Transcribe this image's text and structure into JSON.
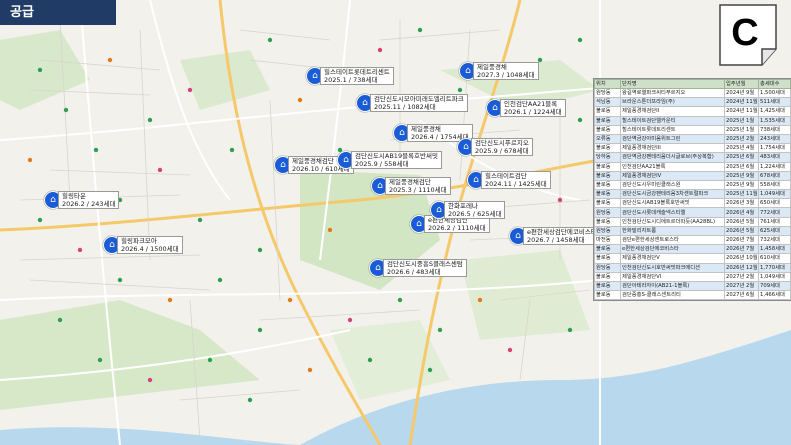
{
  "header": {
    "title": "공급"
  },
  "logo": {
    "letter": "C"
  },
  "callouts": [
    {
      "name": "callout-1",
      "lines": [
        "힐스테이트롯데트리센트",
        "2025.1 / 738세대"
      ]
    },
    {
      "name": "callout-2",
      "lines": [
        "제일풍경채",
        "2027.3 / 1048세대"
      ]
    },
    {
      "name": "callout-3",
      "lines": [
        "검단신도시모아미래도엘리트파크",
        "2025.11 / 1082세대"
      ]
    },
    {
      "name": "callout-4",
      "lines": [
        "인천검단AA21블록",
        "2026.1 / 1224세대"
      ]
    },
    {
      "name": "callout-5",
      "lines": [
        "제일풍경채",
        "2026.4 / 1754세대"
      ]
    },
    {
      "name": "callout-6",
      "lines": [
        "검단신도시푸르지오",
        "2025.9 / 678세대"
      ]
    },
    {
      "name": "callout-7",
      "lines": [
        "제일풍경채검단",
        "2026.10 / 610세대"
      ]
    },
    {
      "name": "callout-8",
      "lines": [
        "검단신도시AB19블록호반써밋",
        "2025.9 / 558세대"
      ]
    },
    {
      "name": "callout-9",
      "lines": [
        "제일풍경채검단",
        "2025.3 / 1110세대"
      ]
    },
    {
      "name": "callout-10",
      "lines": [
        "힐스테이트검단",
        "2024.11 / 1425세대"
      ]
    },
    {
      "name": "callout-11",
      "lines": [
        "e편한세상검단",
        "2026.2 / 1110세대"
      ]
    },
    {
      "name": "callout-12",
      "lines": [
        "한화포레나",
        "2026.5 / 625세대"
      ]
    },
    {
      "name": "callout-13",
      "lines": [
        "e편한세상검단에코비스타",
        "2026.7 / 1458세대"
      ]
    },
    {
      "name": "callout-14",
      "lines": [
        "힐링타운",
        "2026.2 / 243세대"
      ]
    },
    {
      "name": "callout-15",
      "lines": [
        "힐링파크모아",
        "2026.4 / 1500세대"
      ]
    },
    {
      "name": "callout-16",
      "lines": [
        "검단신도시중흥S클래스센텀",
        "2026.6 / 483세대"
      ]
    }
  ],
  "supply_table": {
    "headers": [
      "위치",
      "단지명",
      "입주년월",
      "총세대수"
    ],
    "rows": [
      {
        "loc": "원당동",
        "name": "왕길역로열파크씨티푸르지오",
        "date": "2024년 9월",
        "units": "1,500세대"
      },
      {
        "loc": "석남동",
        "name": "브라운스톤더프라임(주)",
        "date": "2024년 11월",
        "units": "511세대"
      },
      {
        "loc": "불로동",
        "name": "제일풍경채검단II",
        "date": "2024년 11월",
        "units": "1,425세대"
      },
      {
        "loc": "불로동",
        "name": "힐스테이트검단웰카운티",
        "date": "2025년 1월",
        "units": "1,535세대"
      },
      {
        "loc": "불로동",
        "name": "힐스테이트롯데트리센트",
        "date": "2025년 1월",
        "units": "738세대"
      },
      {
        "loc": "오류동",
        "name": "검단역금강아미움위트그린",
        "date": "2025년 2월",
        "units": "243세대"
      },
      {
        "loc": "불로동",
        "name": "제일풍경채검단III",
        "date": "2025년 4월",
        "units": "1,754세대"
      },
      {
        "loc": "당하동",
        "name": "검단역금강펜테리움더시글로브(주상복합)",
        "date": "2025년 6월",
        "units": "483세대"
      },
      {
        "loc": "불로동",
        "name": "인천검단AA21블록",
        "date": "2025년 6월",
        "units": "1,224세대"
      },
      {
        "loc": "불로동",
        "name": "제일풍경채검단IV",
        "date": "2025년 9월",
        "units": "678세대"
      },
      {
        "loc": "불로동",
        "name": "검단신도시우미린클래스원",
        "date": "2025년 9월",
        "units": "558세대"
      },
      {
        "loc": "불로동",
        "name": "검단신도시금강펜테리움3차센트럴파크",
        "date": "2025년 11월",
        "units": "1,049세대"
      },
      {
        "loc": "불로동",
        "name": "검단신도시AB19블록호반써밋",
        "date": "2026년 3월",
        "units": "650세대"
      },
      {
        "loc": "원당동",
        "name": "검단신도시롯데캐슬넥스티엘",
        "date": "2026년 4월",
        "units": "772세대"
      },
      {
        "loc": "불로동",
        "name": "인천검단신도시디에트르더따듯(AA28BL)",
        "date": "2026년 5월",
        "units": "761세대"
      },
      {
        "loc": "원당동",
        "name": "한화빌리지트룸",
        "date": "2026년 5월",
        "units": "625세대"
      },
      {
        "loc": "마전동",
        "name": "검단e편한세상센트로스타",
        "date": "2026년 7월",
        "units": "732세대"
      },
      {
        "loc": "불로동",
        "name": "e편한세상검단에코비스타",
        "date": "2026년 7월",
        "units": "1,458세대"
      },
      {
        "loc": "불로동",
        "name": "제일풍경채검단V",
        "date": "2026년 10월",
        "units": "610세대"
      },
      {
        "loc": "원당동",
        "name": "인천검단신도시호반써밋파크에디션",
        "date": "2026년 12월",
        "units": "1,770세대"
      },
      {
        "loc": "불로동",
        "name": "제일풍경채검단VI",
        "date": "2027년 2월",
        "units": "1,049세대"
      },
      {
        "loc": "불로동",
        "name": "검단아테라자이(AB21-1블록)",
        "date": "2027년 2월",
        "units": "709세대"
      },
      {
        "loc": "불로동",
        "name": "검단중흥S-클래스센트리티",
        "date": "2027년 6월",
        "units": "1,466세대"
      }
    ]
  }
}
